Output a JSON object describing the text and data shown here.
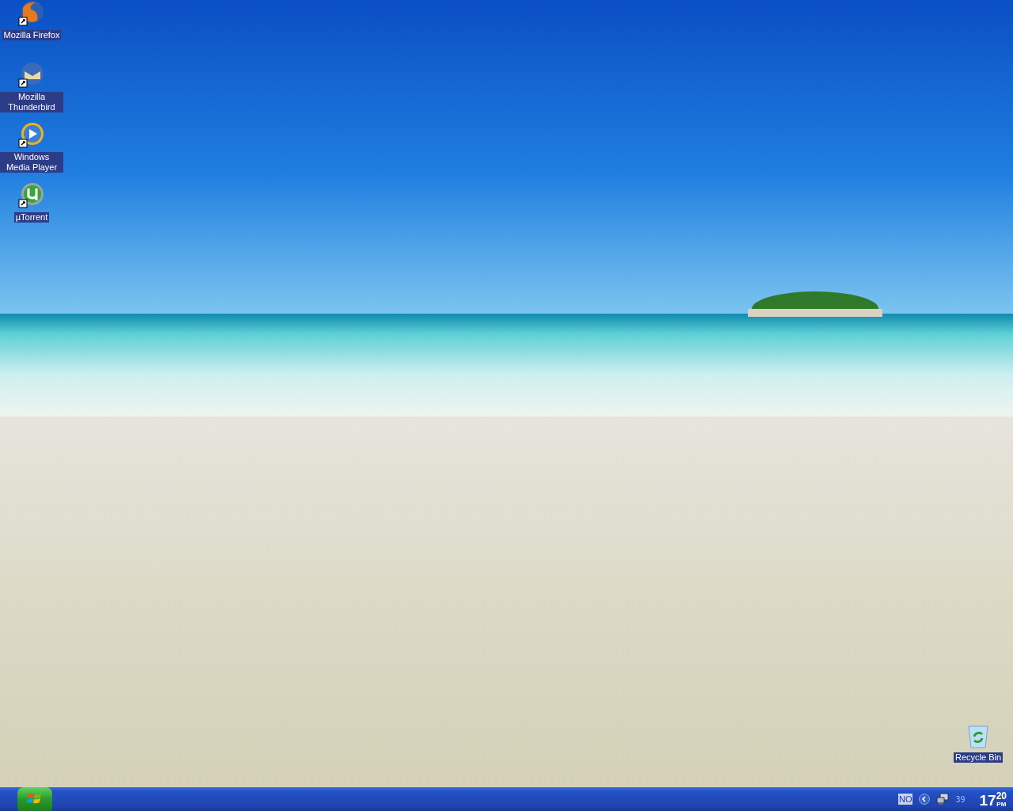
{
  "desktop": {
    "icons": [
      {
        "label": "Mozilla Firefox",
        "kind": "browser"
      },
      {
        "label": "Mozilla Thunderbird",
        "kind": "mail"
      },
      {
        "label": "Windows Media Player",
        "kind": "media"
      },
      {
        "label": "µTorrent",
        "kind": "torrent"
      }
    ],
    "recycle_bin": {
      "label": "Recycle Bin"
    }
  },
  "taskbar": {
    "language": "NO",
    "tray_text": "39",
    "clock": {
      "hour": "17",
      "minutes": "20",
      "period": "PM"
    }
  }
}
